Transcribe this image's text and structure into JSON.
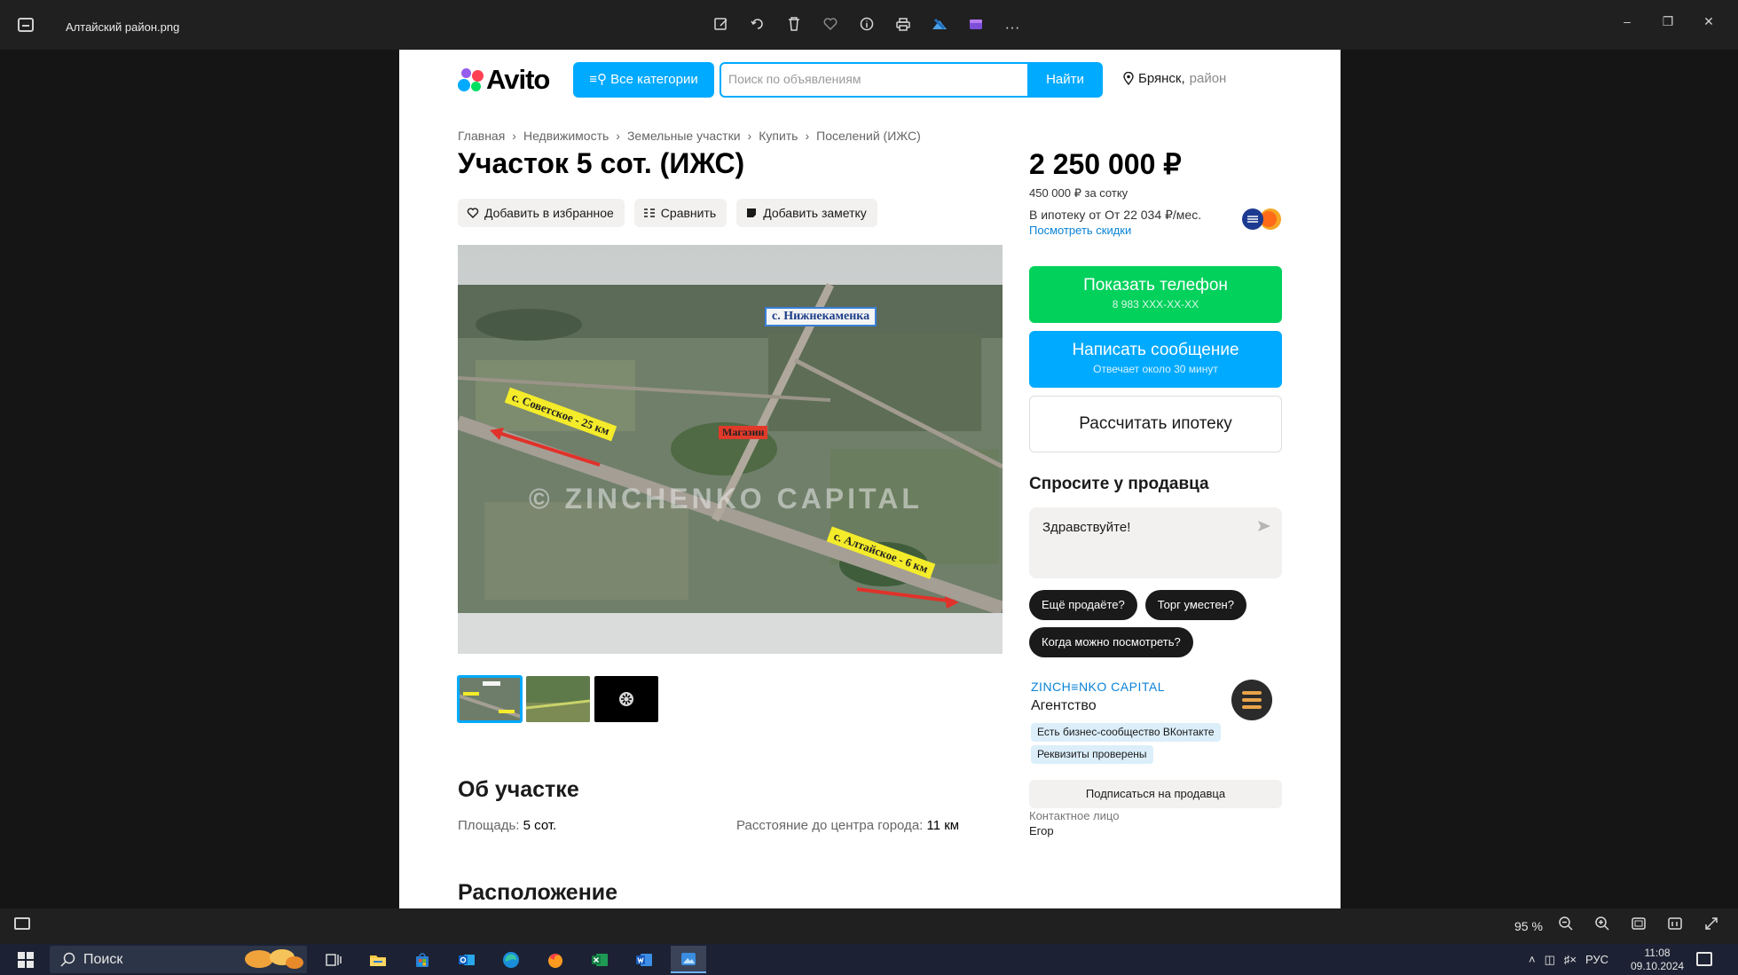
{
  "window": {
    "filename": "Алтайский район.png",
    "toolbar_icons": [
      "edit-icon",
      "rotate-icon",
      "delete-icon",
      "favorite-icon",
      "info-icon",
      "print-icon",
      "edit-app-icon",
      "clipchamp-icon",
      "more-icon"
    ]
  },
  "site": {
    "logo_text": "Avito",
    "categories_button": "Все категории",
    "search_placeholder": "Поиск по объявлениям",
    "search_button": "Найти",
    "location_city": "Брянск,",
    "location_suffix": "район"
  },
  "breadcrumb": [
    "Главная",
    "Недвижимость",
    "Земельные участки",
    "Купить",
    "Поселений (ИЖС)"
  ],
  "listing": {
    "title": "Участок 5 сот. (ИЖС)",
    "actions": {
      "favorite": "Добавить в избранное",
      "compare": "Сравнить",
      "note": "Добавить заметку"
    },
    "photo_labels": {
      "village": "с. Нижнекаменка",
      "left_road": "с. Советское - 25 км",
      "right_road": "с. Алтайское - 6 км",
      "shop": "Магазин",
      "watermark": "© ZINCHENKO CAPITAL"
    },
    "thumbnails": [
      "thumb-map",
      "thumb-field",
      "thumb-more"
    ],
    "about_heading": "Об участке",
    "area_label": "Площадь:",
    "area_value": "5 сот.",
    "distance_label": "Расстояние до центра города:",
    "distance_value": "11 км",
    "location_heading": "Расположение"
  },
  "sidebar": {
    "price": "2 250 000 ₽",
    "price_per_sotka": "450 000 ₽ за сотку",
    "mortgage": "В ипотеку от От 22 034 ₽/мес.",
    "discounts_link": "Посмотреть скидки",
    "phone_button": "Показать телефон",
    "phone_masked": "8 983 XXX-XX-XX",
    "message_button": "Написать сообщение",
    "message_sub": "Отвечает около 30 минут",
    "mortgage_button": "Рассчитать ипотеку",
    "ask_heading": "Спросите у продавца",
    "ask_text": "Здравствуйте!",
    "quick_questions": [
      "Ещё продаёте?",
      "Торг уместен?",
      "Когда можно посмотреть?"
    ],
    "seller_name": "ZINCH≡NKO CAPITAL",
    "seller_type": "Агентство",
    "badges": [
      "Есть бизнес-сообщество ВКонтакте",
      "Реквизиты проверены"
    ],
    "subscribe_button": "Подписаться на продавца",
    "contact_label": "Контактное лицо",
    "contact_name": "Егор"
  },
  "statusbar": {
    "zoom": "95 %",
    "icons": [
      "zoom-out-icon",
      "zoom-in-icon",
      "fit-icon",
      "actual-size-icon",
      "fullscreen-icon"
    ]
  },
  "taskbar": {
    "search_label": "Поиск",
    "apps": [
      "task-view-icon",
      "file-explorer-icon",
      "store-icon",
      "outlook-icon",
      "edge-icon",
      "firefox-icon",
      "excel-icon",
      "word-icon",
      "photos-icon"
    ],
    "language": "РУС",
    "time": "11:08",
    "date": "09.10.2024"
  },
  "colors": {
    "avito_blue": "#00AAFF",
    "avito_green": "#02D15C",
    "link_blue": "#0a83d8"
  }
}
